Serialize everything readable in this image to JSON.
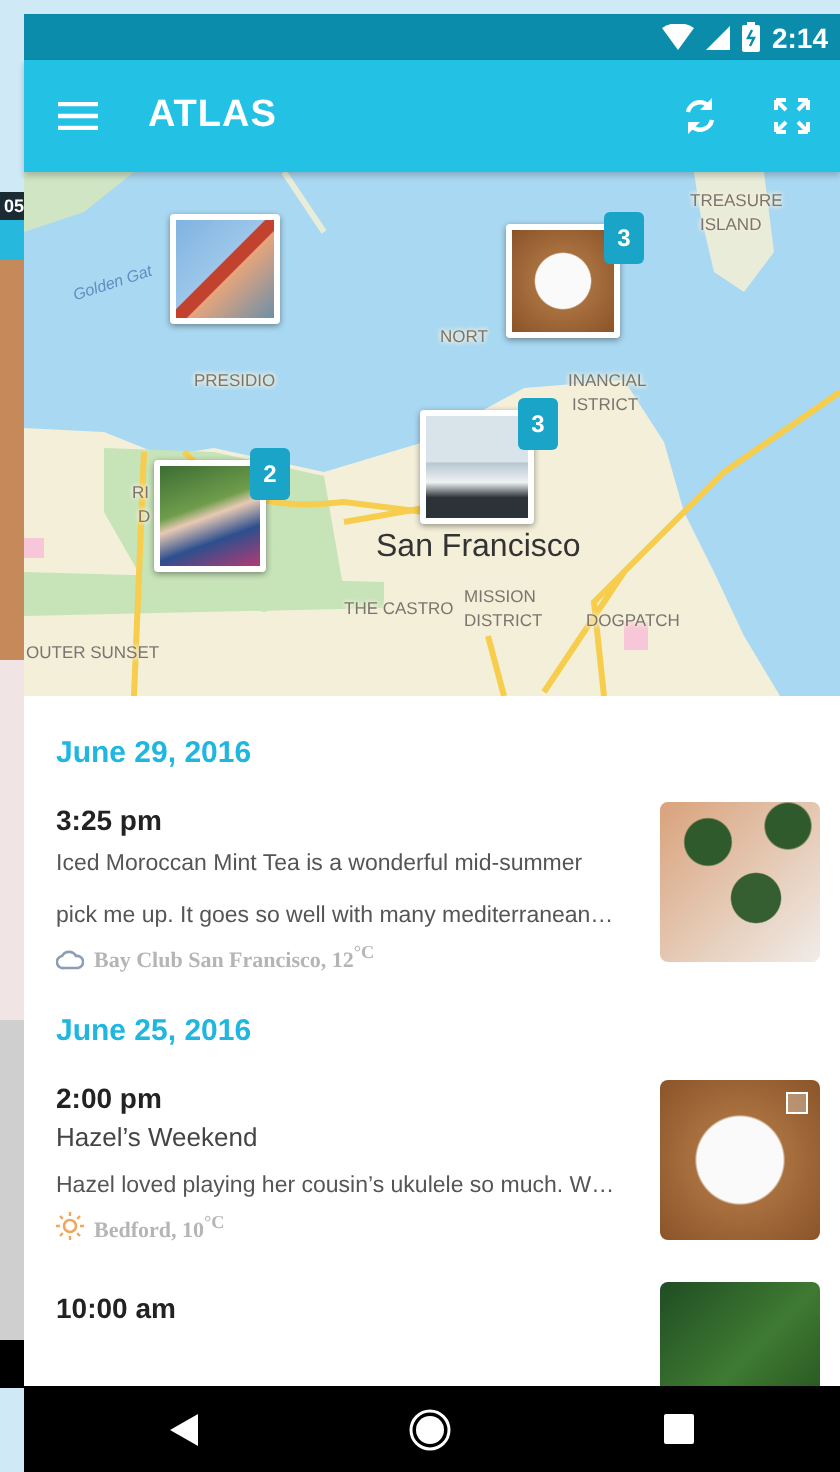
{
  "background_screen": {
    "label": "05"
  },
  "status_bar": {
    "time": "2:14"
  },
  "app_bar": {
    "title": "ATLAS"
  },
  "map": {
    "labels": [
      {
        "text": "Golden Gat",
        "kind": "water"
      },
      {
        "text": "TREASURE",
        "kind": "district"
      },
      {
        "text": "ISLAND",
        "kind": "district"
      },
      {
        "text": "NORT",
        "kind": "district"
      },
      {
        "text": "PRESIDIO",
        "kind": "district"
      },
      {
        "text": "INANCIAL",
        "kind": "district"
      },
      {
        "text": "ISTRICT",
        "kind": "district"
      },
      {
        "text": "RI",
        "kind": "district"
      },
      {
        "text": "D",
        "kind": "district"
      },
      {
        "text": "San Francisco",
        "kind": "city"
      },
      {
        "text": "THE CASTRO",
        "kind": "district"
      },
      {
        "text": "MISSION",
        "kind": "district"
      },
      {
        "text": "DISTRICT",
        "kind": "district"
      },
      {
        "text": "DOGPATCH",
        "kind": "district"
      },
      {
        "text": "OUTER SUNSET",
        "kind": "district"
      }
    ],
    "markers": [
      {
        "kind": "single"
      },
      {
        "kind": "cluster",
        "badge": "3"
      },
      {
        "kind": "cluster",
        "badge": "3"
      },
      {
        "kind": "cluster",
        "badge": "2"
      }
    ]
  },
  "feed": [
    {
      "date": "June 29, 2016",
      "entries": [
        {
          "time": "3:25 pm",
          "lines": [
            "Iced Moroccan Mint Tea is a wonderful mid-summer",
            "pick me up. It goes so well with many mediterranean…"
          ],
          "location": "Bay Club San Francisco, 12$^{°C}$",
          "kind": "cloud"
        }
      ]
    },
    {
      "date": "June 25, 2016",
      "entries": [
        {
          "time": "2:00 pm",
          "title": "Hazel’s Weekend",
          "lines": [
            "Hazel loved playing her cousin’s ukulele so much. W…"
          ],
          "location": "Bedford, 10$^{°C}$",
          "kind": "sun",
          "gallery": true
        },
        {
          "time": "10:00 am"
        }
      ]
    }
  ]
}
